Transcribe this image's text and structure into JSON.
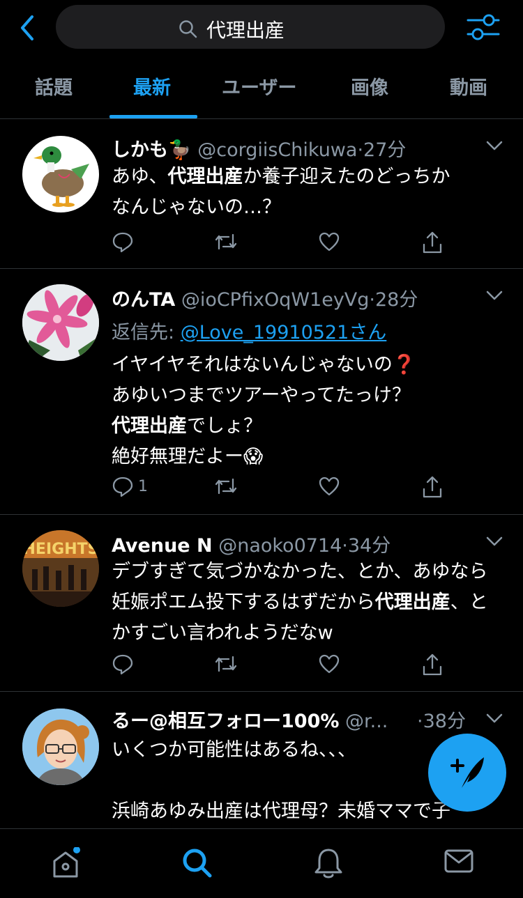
{
  "search": {
    "query": "代理出産"
  },
  "tabs": [
    {
      "label": "話題"
    },
    {
      "label": "最新"
    },
    {
      "label": "ユーザー"
    },
    {
      "label": "画像"
    },
    {
      "label": "動画"
    }
  ],
  "active_tab": "最新",
  "tweets": [
    {
      "name": "しかも🦆",
      "handle": "@corgiisChikuwa",
      "time": "·27分",
      "text": [
        "あゆ、",
        "代理出産",
        "か養子迎えたのどっちか\nなんじゃないの…？"
      ],
      "reply_count": ""
    },
    {
      "name": "のんTA",
      "handle": "@ioCPfixOqW1eyVg",
      "time": "·28分",
      "reply_to_label": "返信先: ",
      "reply_to_user": "@Love_19910521さん",
      "text_lines": [
        "イヤイヤそれはないんじゃないの❓",
        "あゆいつまでツアーやってたっけ？",
        "代理出産",
        "でしょ？",
        "絶好無理だよー😱"
      ],
      "reply_count": "1"
    },
    {
      "name": "Avenue N",
      "handle": "@naoko0714",
      "time": "·34分",
      "text": [
        "デブすぎて気づかなかった、とか、あゆなら妊娠ポエム投下するはずだから",
        "代理出産",
        "、とかすごい言われようだなw"
      ],
      "reply_count": ""
    },
    {
      "name": "るー@相互フォロー100%",
      "handle": "@r...",
      "time": "·38分",
      "text_lines": [
        "いくつか可能性はあるね、、、",
        "",
        "浜崎あゆみ出産は代理母？未婚ママで子"
      ],
      "reply_count": ""
    }
  ],
  "icons": {
    "back": "chevron-left-icon",
    "search": "search-icon",
    "filter": "filter-sliders-icon",
    "reply": "reply-icon",
    "retweet": "retweet-icon",
    "like": "heart-icon",
    "share": "share-icon",
    "compose": "compose-tweet-icon",
    "home": "home-icon",
    "explore": "search-icon",
    "notifications": "bell-icon",
    "messages": "mail-icon"
  },
  "colors": {
    "accent": "#1da1f2",
    "muted": "#8b98a5",
    "background": "#000000"
  }
}
